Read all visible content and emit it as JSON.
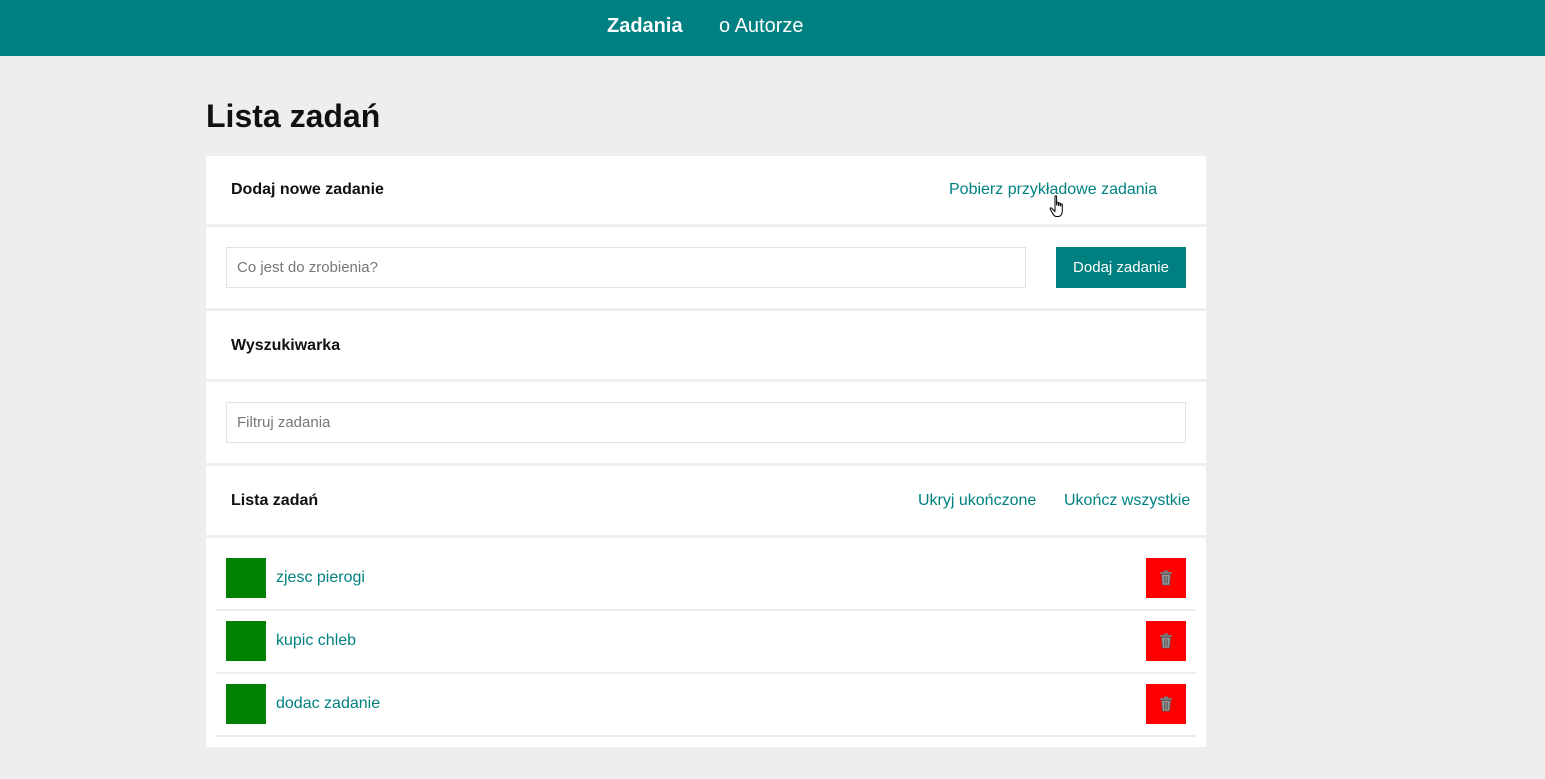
{
  "nav": {
    "items": [
      {
        "label": "Zadania"
      },
      {
        "label": "o Autorze"
      }
    ]
  },
  "page": {
    "title": "Lista zadań"
  },
  "add_section": {
    "header": "Dodaj nowe zadanie",
    "sample_link": "Pobierz przykładowe zadania",
    "input_placeholder": "Co jest do zrobienia?",
    "add_button": "Dodaj zadanie"
  },
  "search_section": {
    "header": "Wyszukiwarka",
    "input_placeholder": "Filtruj zadania"
  },
  "list_section": {
    "header": "Lista zadań",
    "hide_completed": "Ukryj ukończone",
    "complete_all": "Ukończ wszystkie"
  },
  "tasks": [
    {
      "label": "zjesc pierogi"
    },
    {
      "label": "kupic chleb"
    },
    {
      "label": "dodac zadanie"
    }
  ],
  "colors": {
    "accent": "#008080",
    "background": "#eeeeec",
    "task_check": "#008000",
    "task_delete": "#ff0000"
  },
  "icons": {
    "delete": "trash-icon",
    "cursor": "hand-pointer-icon"
  }
}
